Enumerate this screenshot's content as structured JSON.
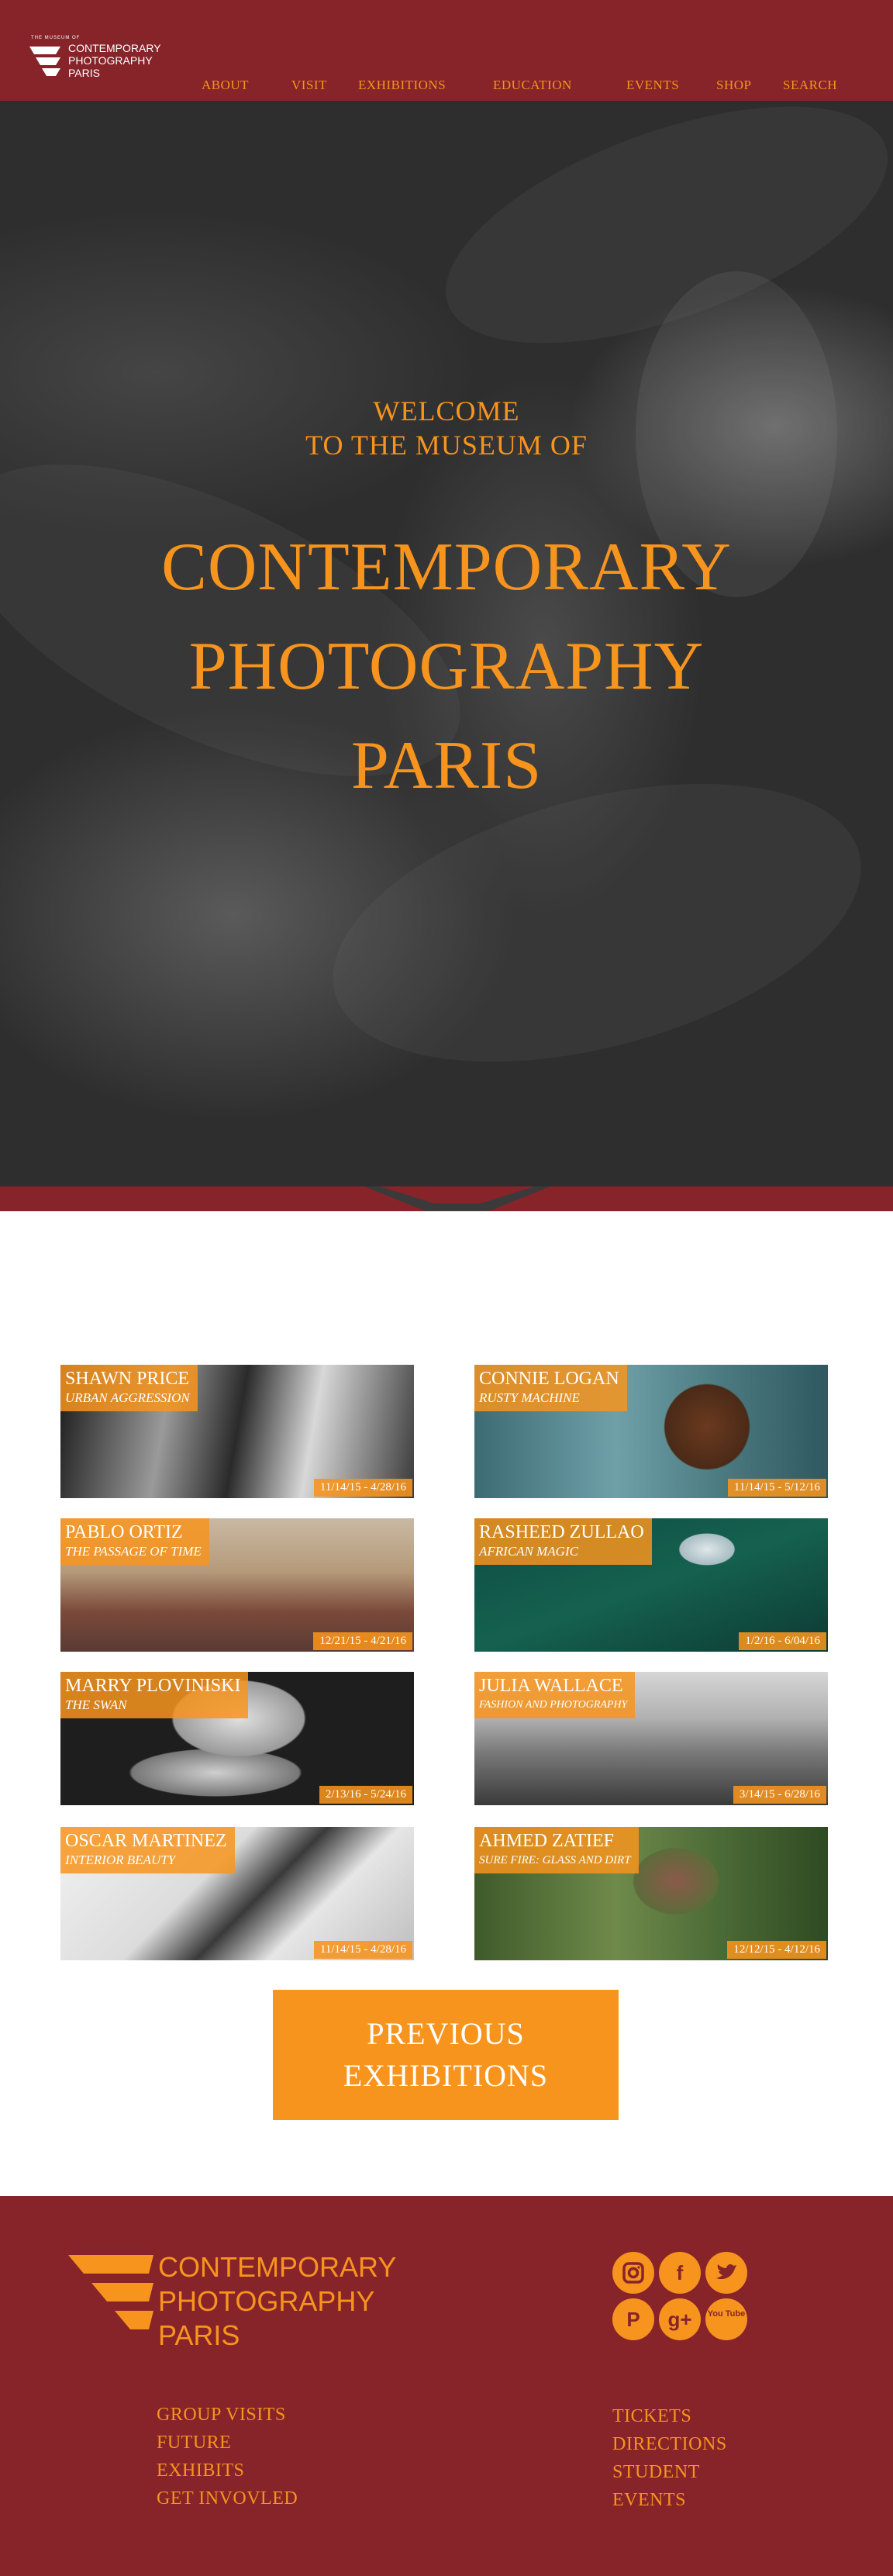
{
  "header": {
    "logo": {
      "small": "THE MUSEUM OF",
      "line1": "CONTEMPORARY",
      "line2": "PHOTOGRAPHY",
      "line3": "PARIS"
    },
    "nav": [
      "ABOUT",
      "VISIT",
      "EXHIBITIONS",
      "EDUCATION",
      "EVENTS",
      "SHOP",
      "SEARCH"
    ]
  },
  "hero": {
    "welcome_1": "WELCOME",
    "welcome_2": "TO THE MUSEUM OF",
    "title_1": "CONTEMPORARY",
    "title_2": "PHOTOGRAPHY",
    "title_3": "PARIS"
  },
  "exhibitions": [
    {
      "name": "SHAWN PRICE",
      "subtitle": "URBAN AGGRESSION",
      "dates": "11/14/15 - 4/28/16"
    },
    {
      "name": "CONNIE LOGAN",
      "subtitle": "RUSTY MACHINE",
      "dates": "11/14/15 - 5/12/16"
    },
    {
      "name": "PABLO ORTIZ",
      "subtitle": "THE PASSAGE OF TIME",
      "dates": "12/21/15 - 4/21/16"
    },
    {
      "name": "RASHEED ZULLAO",
      "subtitle": "AFRICAN MAGIC",
      "dates": "1/2/16 - 6/04/16"
    },
    {
      "name": "MARRY PLOVINISKI",
      "subtitle": "THE SWAN",
      "dates": "2/13/16 - 5/24/16"
    },
    {
      "name": "JULIA WALLACE",
      "subtitle": "FASHION AND PHOTOGRAPHY",
      "dates": "3/14/15 - 6/28/16"
    },
    {
      "name": "OSCAR MARTINEZ",
      "subtitle": "INTERIOR BEAUTY",
      "dates": "11/14/15 - 4/28/16"
    },
    {
      "name": "AHMED ZATIEF",
      "subtitle": "SURE FIRE: GLASS AND DIRT",
      "dates": "12/12/15 - 4/12/16"
    }
  ],
  "previous_button": {
    "line1": "PREVIOUS",
    "line2": "EXHIBITIONS"
  },
  "footer": {
    "logo": {
      "line1": "CONTEMPORARY",
      "line2": "PHOTOGRAPHY",
      "line3": "PARIS"
    },
    "social": [
      {
        "icon": "instagram-icon",
        "glyph": "◎"
      },
      {
        "icon": "facebook-icon",
        "glyph": "f"
      },
      {
        "icon": "twitter-icon",
        "glyph": "🐦"
      },
      {
        "icon": "pinterest-icon",
        "glyph": "P"
      },
      {
        "icon": "google-plus-icon",
        "glyph": "g+"
      },
      {
        "icon": "youtube-icon",
        "glyph": "You Tube"
      }
    ],
    "links_left": [
      "GROUP VISITS",
      "FUTURE",
      "EXHIBITS",
      "GET INVOVLED"
    ],
    "links_right": [
      "TICKETS",
      "DIRECTIONS",
      "STUDENT",
      "EVENTS"
    ]
  },
  "colors": {
    "brand_red": "#86242a",
    "accent_orange": "#f7941d"
  }
}
